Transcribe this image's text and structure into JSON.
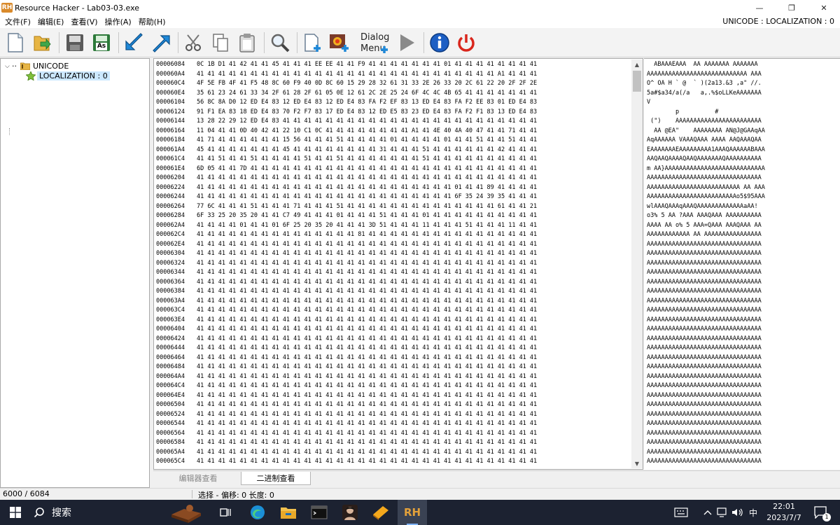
{
  "window": {
    "app_badge": "RH",
    "title": "Resource Hacker - Lab03-03.exe",
    "minimize": "—",
    "restore": "❐",
    "close": "✕"
  },
  "menu": {
    "items": [
      "文件(F)",
      "编辑(E)",
      "查看(V)",
      "操作(A)",
      "帮助(H)"
    ],
    "resource_indicator": "UNICODE : LOCALIZATION : 0"
  },
  "toolbar": {
    "buttons": [
      "new-file-icon",
      "open-folder-icon",
      "save-icon",
      "save-as-icon",
      "back-arrow-icon",
      "forward-arrow-icon",
      "cut-icon",
      "copy-icon",
      "paste-icon",
      "find-icon",
      "add-resource-icon",
      "add-image-icon",
      "add-dialog-icon",
      "run-script-icon",
      "info-icon",
      "power-icon"
    ],
    "save_as_label": "As",
    "dialog_label_1": "Dialog",
    "dialog_label_2": "Menu"
  },
  "tree": {
    "root_label": "UNICODE",
    "child_label": "LOCALIZATION : 0"
  },
  "hex": {
    "rows": [
      {
        "addr": "00006084",
        "bytes": "0C 1B D1 41 42 41 41 45 41 41 41 EE EE 41 41 F9 41 41 41 41 41 41 41 01 41 41 41 41 41 41 41 41"
      },
      {
        "addr": "000060A4",
        "bytes": "41 41 41 41 41 41 41 41 41 41 41 41 41 41 41 41 41 41 41 41 41 41 41 41 41 41 41 41 A1 41 41 41"
      },
      {
        "addr": "000060C4",
        "bytes": "4F 5E FB 4F 41 F5 48 8C 60 F9 40 0D 8C 60 15 29 28 32 61 31 33 2E 26 33 20 2C 61 22 20 2F 2F 2E"
      },
      {
        "addr": "000060E4",
        "bytes": "35 61 23 24 61 33 34 2F 61 28 2F 61 05 0E 12 61 2C 2E 25 24 6F 4C 4C 4B 65 41 41 41 41 41 41 41"
      },
      {
        "addr": "00006104",
        "bytes": "56 8C 8A D0 12 ED E4 83 12 ED E4 83 12 ED E4 83 FA F2 EF 83 13 ED E4 83 FA F2 EE 83 01 ED E4 83"
      },
      {
        "addr": "00006124",
        "bytes": "91 F1 EA 83 18 ED E4 83 70 F2 F7 83 17 ED E4 83 12 ED E5 83 23 ED E4 83 FA F2 F1 83 13 ED E4 83"
      },
      {
        "addr": "00006144",
        "bytes": "13 28 22 29 12 ED E4 83 41 41 41 41 41 41 41 41 41 41 41 41 41 41 41 41 41 41 41 41 41 41 41 41"
      },
      {
        "addr": "00006164",
        "bytes": "11 04 41 41 0D 40 42 41 22 10 C1 0C 41 41 41 41 41 41 41 41 A1 41 4E 40 4A 40 47 41 41 71 41 41"
      },
      {
        "addr": "00006184",
        "bytes": "41 71 41 41 41 41 41 41 15 56 41 41 41 51 41 41 41 41 01 41 41 41 41 01 41 41 51 41 41 51 41 41"
      },
      {
        "addr": "000061A4",
        "bytes": "45 41 41 41 41 41 41 41 45 41 41 41 41 41 41 41 41 31 41 41 41 51 41 41 41 41 41 41 42 41 41 41"
      },
      {
        "addr": "000061C4",
        "bytes": "41 41 51 41 41 51 41 41 41 41 51 41 41 51 41 41 41 41 41 41 41 51 41 41 41 41 41 41 41 41 41 41"
      },
      {
        "addr": "000061E4",
        "bytes": "6D 05 41 41 7D 41 41 41 41 41 41 41 41 41 41 41 41 41 41 41 41 41 41 41 41 41 41 41 41 41 41 41"
      },
      {
        "addr": "00006204",
        "bytes": "41 41 41 41 41 41 41 41 41 41 41 41 41 41 41 41 41 41 41 41 41 41 41 41 41 41 41 41 41 41 41 41"
      },
      {
        "addr": "00006224",
        "bytes": "41 41 41 41 41 41 41 41 41 41 41 41 41 41 41 41 41 41 41 41 41 41 41 41 01 41 41 89 41 41 41 41"
      },
      {
        "addr": "00006244",
        "bytes": "41 41 41 41 41 41 41 41 41 41 41 41 41 41 41 41 41 41 41 41 41 41 41 41 6F 35 24 39 35 41 41 41"
      },
      {
        "addr": "00006264",
        "bytes": "77 6C 41 41 41 51 41 41 41 71 41 41 41 51 41 41 41 41 41 41 41 41 41 41 41 41 41 41 61 41 41 21"
      },
      {
        "addr": "00006284",
        "bytes": "6F 33 25 20 35 20 41 41 C7 49 41 41 41 01 41 41 41 51 41 41 41 01 41 41 41 41 41 41 41 41 41 41"
      },
      {
        "addr": "000062A4",
        "bytes": "41 41 41 41 01 41 41 01 6F 25 20 35 20 41 41 41 3D 51 41 41 41 11 41 41 41 51 41 41 41 11 41 41"
      },
      {
        "addr": "000062C4",
        "bytes": "41 41 41 41 41 41 41 41 41 41 41 41 41 41 41 81 41 41 41 41 41 41 41 41 41 41 41 41 41 41 41 41"
      },
      {
        "addr": "000062E4",
        "bytes": "41 41 41 41 41 41 41 41 41 41 41 41 41 41 41 41 41 41 41 41 41 41 41 41 41 41 41 41 41 41 41 41"
      },
      {
        "addr": "00006304",
        "bytes": "41 41 41 41 41 41 41 41 41 41 41 41 41 41 41 41 41 41 41 41 41 41 41 41 41 41 41 41 41 41 41 41"
      },
      {
        "addr": "00006324",
        "bytes": "41 41 41 41 41 41 41 41 41 41 41 41 41 41 41 41 41 41 41 41 41 41 41 41 41 41 41 41 41 41 41 41"
      },
      {
        "addr": "00006344",
        "bytes": "41 41 41 41 41 41 41 41 41 41 41 41 41 41 41 41 41 41 41 41 41 41 41 41 41 41 41 41 41 41 41 41"
      },
      {
        "addr": "00006364",
        "bytes": "41 41 41 41 41 41 41 41 41 41 41 41 41 41 41 41 41 41 41 41 41 41 41 41 41 41 41 41 41 41 41 41"
      },
      {
        "addr": "00006384",
        "bytes": "41 41 41 41 41 41 41 41 41 41 41 41 41 41 41 41 41 41 41 41 41 41 41 41 41 41 41 41 41 41 41 41"
      },
      {
        "addr": "000063A4",
        "bytes": "41 41 41 41 41 41 41 41 41 41 41 41 41 41 41 41 41 41 41 41 41 41 41 41 41 41 41 41 41 41 41 41"
      },
      {
        "addr": "000063C4",
        "bytes": "41 41 41 41 41 41 41 41 41 41 41 41 41 41 41 41 41 41 41 41 41 41 41 41 41 41 41 41 41 41 41 41"
      },
      {
        "addr": "000063E4",
        "bytes": "41 41 41 41 41 41 41 41 41 41 41 41 41 41 41 41 41 41 41 41 41 41 41 41 41 41 41 41 41 41 41 41"
      },
      {
        "addr": "00006404",
        "bytes": "41 41 41 41 41 41 41 41 41 41 41 41 41 41 41 41 41 41 41 41 41 41 41 41 41 41 41 41 41 41 41 41"
      },
      {
        "addr": "00006424",
        "bytes": "41 41 41 41 41 41 41 41 41 41 41 41 41 41 41 41 41 41 41 41 41 41 41 41 41 41 41 41 41 41 41 41"
      },
      {
        "addr": "00006444",
        "bytes": "41 41 41 41 41 41 41 41 41 41 41 41 41 41 41 41 41 41 41 41 41 41 41 41 41 41 41 41 41 41 41 41"
      },
      {
        "addr": "00006464",
        "bytes": "41 41 41 41 41 41 41 41 41 41 41 41 41 41 41 41 41 41 41 41 41 41 41 41 41 41 41 41 41 41 41 41"
      },
      {
        "addr": "00006484",
        "bytes": "41 41 41 41 41 41 41 41 41 41 41 41 41 41 41 41 41 41 41 41 41 41 41 41 41 41 41 41 41 41 41 41"
      },
      {
        "addr": "000064A4",
        "bytes": "41 41 41 41 41 41 41 41 41 41 41 41 41 41 41 41 41 41 41 41 41 41 41 41 41 41 41 41 41 41 41 41"
      },
      {
        "addr": "000064C4",
        "bytes": "41 41 41 41 41 41 41 41 41 41 41 41 41 41 41 41 41 41 41 41 41 41 41 41 41 41 41 41 41 41 41 41"
      },
      {
        "addr": "000064E4",
        "bytes": "41 41 41 41 41 41 41 41 41 41 41 41 41 41 41 41 41 41 41 41 41 41 41 41 41 41 41 41 41 41 41 41"
      },
      {
        "addr": "00006504",
        "bytes": "41 41 41 41 41 41 41 41 41 41 41 41 41 41 41 41 41 41 41 41 41 41 41 41 41 41 41 41 41 41 41 41"
      },
      {
        "addr": "00006524",
        "bytes": "41 41 41 41 41 41 41 41 41 41 41 41 41 41 41 41 41 41 41 41 41 41 41 41 41 41 41 41 41 41 41 41"
      },
      {
        "addr": "00006544",
        "bytes": "41 41 41 41 41 41 41 41 41 41 41 41 41 41 41 41 41 41 41 41 41 41 41 41 41 41 41 41 41 41 41 41"
      },
      {
        "addr": "00006564",
        "bytes": "41 41 41 41 41 41 41 41 41 41 41 41 41 41 41 41 41 41 41 41 41 41 41 41 41 41 41 41 41 41 41 41"
      },
      {
        "addr": "00006584",
        "bytes": "41 41 41 41 41 41 41 41 41 41 41 41 41 41 41 41 41 41 41 41 41 41 41 41 41 41 41 41 41 41 41 41"
      },
      {
        "addr": "000065A4",
        "bytes": "41 41 41 41 41 41 41 41 41 41 41 41 41 41 41 41 41 41 41 41 41 41 41 41 41 41 41 41 41 41 41 41"
      },
      {
        "addr": "000065C4",
        "bytes": "41 41 41 41 41 41 41 41 41 41 41 41 41 41 41 41 41 41 41 41 41 41 41 41 41 41 41 41 41 41 41 41"
      }
    ]
  },
  "ascii": {
    "rows": [
      "  ABAAAEAAA  AA AAAAAAA AAAAAAA",
      "AAAAAAAAAAAAAAAAAAAAAAAAAAAA AAA",
      "O^ OA H ` @  ` )(2a13.&3 ,a\" //.",
      "5a#$a34/a(/a   a,.%$oLLKeAAAAAAA",
      "V",
      "        p          #",
      " (\")    AAAAAAAAAAAAAAAAAAAAAAAA",
      "  AA @EA\"    AAAAAAAA AN@J@GAAqAA",
      "AqAAAAAA VAAAQAAA AAAA AAQAAAQAA",
      "EAAAAAAAEAAAAAAAAA1AAAQAAAAAABAAA",
      "AAQAAQAAAAQAAQAAAAAAAQAAAAAAAAAA",
      "m AA}AAAAAAAAAAAAAAAAAAAAAAAAAAAA",
      "AAAAAAAAAAAAAAAAAAAAAAAAAAAAAAAA",
      "AAAAAAAAAAAAAAAAAAAAAAAAAA AA AAA",
      "AAAAAAAAAAAAAAAAAAAAAAAAAo5$95AAA",
      "wlAAAQAAAqAAAQAAAAAAAAAAAAAaAA!",
      "o3% 5 AA ?AAA AAAQAAA AAAAAAAAAA",
      "AAAA AA o% 5 AAA=QAAA AAAQAAA AA",
      "AAAAAAAAAAAA AA AAAAAAAAAAAAAAAA",
      "AAAAAAAAAAAAAAAAAAAAAAAAAAAAAAAA",
      "AAAAAAAAAAAAAAAAAAAAAAAAAAAAAAAA",
      "AAAAAAAAAAAAAAAAAAAAAAAAAAAAAAAA",
      "AAAAAAAAAAAAAAAAAAAAAAAAAAAAAAAA",
      "AAAAAAAAAAAAAAAAAAAAAAAAAAAAAAAA",
      "AAAAAAAAAAAAAAAAAAAAAAAAAAAAAAAA",
      "AAAAAAAAAAAAAAAAAAAAAAAAAAAAAAAA",
      "AAAAAAAAAAAAAAAAAAAAAAAAAAAAAAAA",
      "AAAAAAAAAAAAAAAAAAAAAAAAAAAAAAAA",
      "AAAAAAAAAAAAAAAAAAAAAAAAAAAAAAAA",
      "AAAAAAAAAAAAAAAAAAAAAAAAAAAAAAAA",
      "AAAAAAAAAAAAAAAAAAAAAAAAAAAAAAAA",
      "AAAAAAAAAAAAAAAAAAAAAAAAAAAAAAAA",
      "AAAAAAAAAAAAAAAAAAAAAAAAAAAAAAAA",
      "AAAAAAAAAAAAAAAAAAAAAAAAAAAAAAAA",
      "AAAAAAAAAAAAAAAAAAAAAAAAAAAAAAAA",
      "AAAAAAAAAAAAAAAAAAAAAAAAAAAAAAAA",
      "AAAAAAAAAAAAAAAAAAAAAAAAAAAAAAAA",
      "AAAAAAAAAAAAAAAAAAAAAAAAAAAAAAAA",
      "AAAAAAAAAAAAAAAAAAAAAAAAAAAAAAAA",
      "AAAAAAAAAAAAAAAAAAAAAAAAAAAAAAAA",
      "AAAAAAAAAAAAAAAAAAAAAAAAAAAAAAAA",
      "AAAAAAAAAAAAAAAAAAAAAAAAAAAAAAAA",
      "AAAAAAAAAAAAAAAAAAAAAAAAAAAAAAAA"
    ]
  },
  "tabs": {
    "editor_view": "编辑器查看",
    "binary_view": "二进制查看"
  },
  "status": {
    "left": "6000 / 6084",
    "right": "选择 - 偏移: 0 长度: 0"
  },
  "taskbar": {
    "search_label": "搜索",
    "rh_badge": "RH",
    "ime": "中",
    "time": "22:01",
    "date": "2023/7/7",
    "notification_count": "1"
  },
  "colors": {
    "selection": "#cce8ff",
    "taskbar": "#1c2231",
    "toolbar_blue": "#1e88d8",
    "power_red": "#d9261c"
  }
}
